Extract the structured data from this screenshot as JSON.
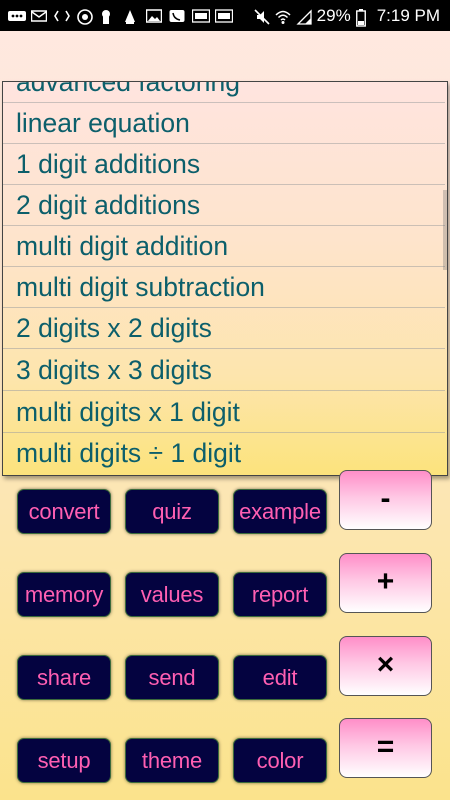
{
  "statusbar": {
    "battery_percent": "29%",
    "time": "7:19 PM"
  },
  "dropdown": {
    "items": [
      "advanced factoring",
      "linear equation",
      "1 digit additions",
      "2 digit additions",
      "multi digit addition",
      "multi digit subtraction",
      "2 digits x 2 digits",
      "3 digits x 3 digits",
      "multi digits x 1 digit",
      "multi digits ÷ 1 digit"
    ]
  },
  "buttons": {
    "convert": "convert",
    "quiz": "quiz",
    "example": "example",
    "memory": "memory",
    "values": "values",
    "report": "report",
    "share": "share",
    "send": "send",
    "edit": "edit",
    "setup": "setup",
    "theme": "theme",
    "color": "color"
  },
  "operators": {
    "minus": "-",
    "plus": "+",
    "times": "×",
    "equals": "="
  },
  "colors": {
    "button_bg": "#040340",
    "button_text": "#ff5fb2",
    "list_text": "#0c5f6b"
  }
}
